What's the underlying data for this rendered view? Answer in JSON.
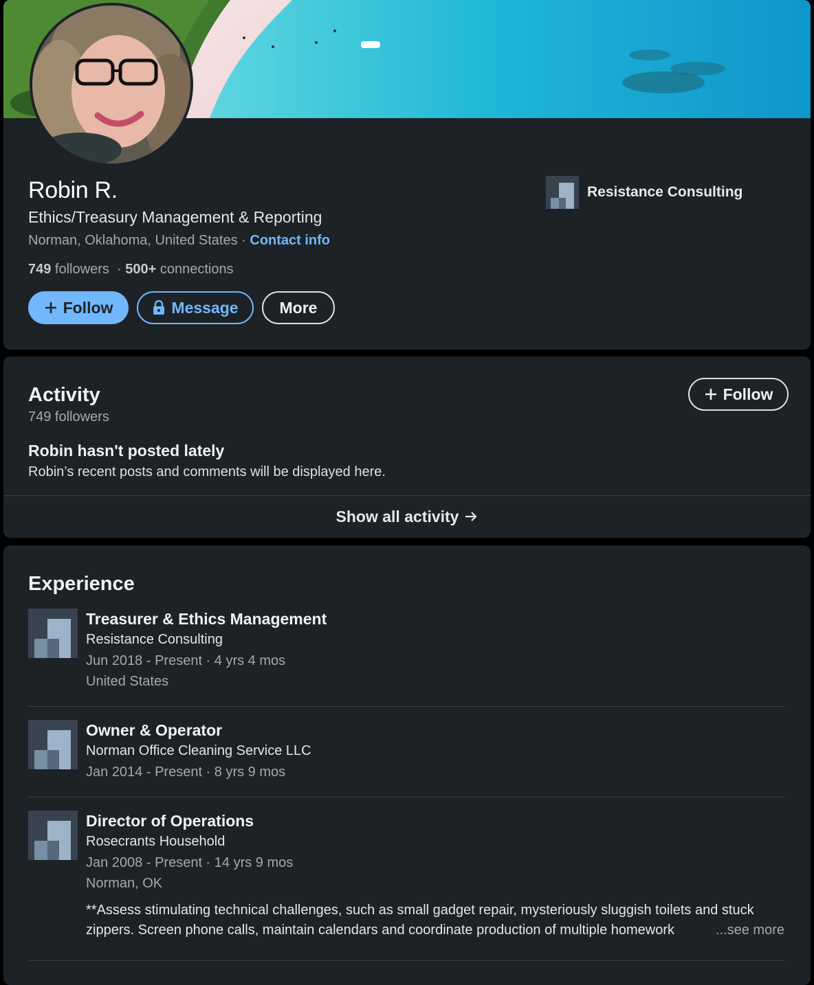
{
  "profile": {
    "name": "Robin R.",
    "headline": "Ethics/Treasury Management & Reporting",
    "location": "Norman, Oklahoma, United States",
    "separator": " · ",
    "contact_info": "Contact info",
    "followers_count": "749",
    "followers_label": " followers",
    "connections_sep": "  · ",
    "connections_count": "500+",
    "connections_label": " connections",
    "current_company": "Resistance Consulting",
    "buttons": {
      "follow": "Follow",
      "message": "Message",
      "more": "More"
    }
  },
  "activity": {
    "title": "Activity",
    "followers": "749 followers",
    "follow_button": "Follow",
    "empty_title": "Robin hasn't posted lately",
    "empty_desc": "Robin’s recent posts and comments will be displayed here.",
    "show_all": "Show all activity"
  },
  "experience": {
    "title": "Experience",
    "items": [
      {
        "title": "Treasurer & Ethics Management",
        "company": "Resistance Consulting",
        "dates": "Jun 2018 - Present · 4 yrs 4 mos",
        "location": "United States"
      },
      {
        "title": "Owner & Operator",
        "company": "Norman Office Cleaning Service LLC",
        "dates": "Jan 2014 - Present · 8 yrs 9 mos"
      },
      {
        "title": "Director of Operations",
        "company": "Rosecrants Household",
        "dates": "Jan 2008 - Present · 14 yrs 9 mos",
        "location": "Norman, OK",
        "description": "**Assess stimulating technical challenges, such as small gadget repair, mysteriously sluggish toilets and stuck zippers. Screen phone calls, maintain calendars and coordinate production of multiple homework",
        "see_more": "...see more"
      }
    ]
  },
  "colors": {
    "card_bg": "#1d2226",
    "page_bg": "#000000",
    "accent": "#71b7fb",
    "muted_text": "#a7a9ab"
  },
  "icons": [
    "plus-icon",
    "lock-icon",
    "arrow-right-icon",
    "company-logo-placeholder-icon"
  ]
}
